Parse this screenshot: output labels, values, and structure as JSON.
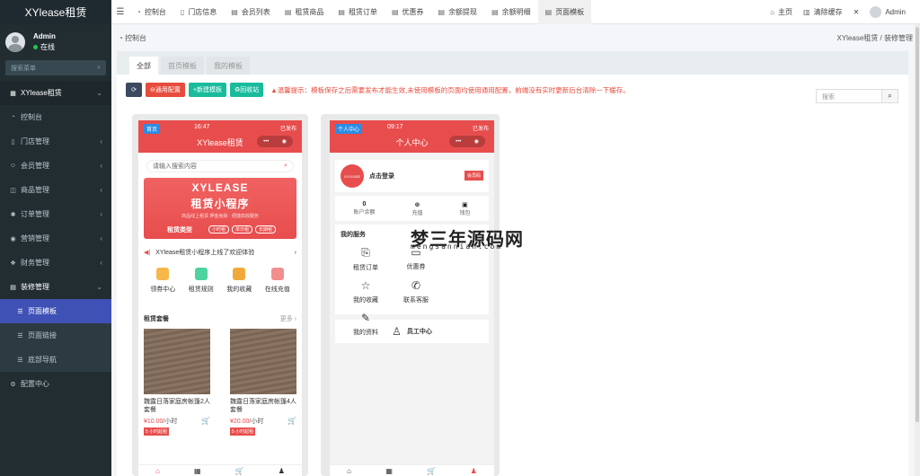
{
  "sidebar": {
    "brand": "XYlease租赁",
    "user": {
      "name": "Admin",
      "status": "在线"
    },
    "search_placeholder": "搜索菜单",
    "items": [
      {
        "label": "XYlease租赁",
        "icon": "grid-icon"
      },
      {
        "label": "控制台",
        "icon": "dashboard-icon"
      },
      {
        "label": "门店管理",
        "icon": "store-icon"
      },
      {
        "label": "会员管理",
        "icon": "user-icon"
      },
      {
        "label": "商品管理",
        "icon": "box-icon"
      },
      {
        "label": "订单管理",
        "icon": "order-icon"
      },
      {
        "label": "营销管理",
        "icon": "marketing-icon"
      },
      {
        "label": "财务管理",
        "icon": "finance-icon"
      },
      {
        "label": "装修管理",
        "icon": "paint-icon"
      },
      {
        "label": "页面模板",
        "icon": "list-icon"
      },
      {
        "label": "页面链接",
        "icon": "list-icon"
      },
      {
        "label": "底部导航",
        "icon": "list-icon"
      },
      {
        "label": "配置中心",
        "icon": "gear-icon"
      }
    ]
  },
  "topbar": {
    "tabs": [
      "控制台",
      "门店信息",
      "会员列表",
      "租赁商品",
      "租赁订单",
      "优惠券",
      "余额提现",
      "余额明细",
      "页面模板"
    ],
    "home": "主页",
    "clear_cache": "清除缓存",
    "admin": "Admin"
  },
  "crumb": {
    "left": "控制台",
    "right1": "XYlease租赁",
    "sep": "/",
    "right2": "装修管理"
  },
  "panel": {
    "tabs": [
      "全部",
      "首页模板",
      "我的模板"
    ],
    "buttons": {
      "general": "通用配置",
      "new": "新建模板",
      "recycle": "回收站"
    },
    "warning": "温馨提示：模板保存之后需要发布才能生效,未使用模板的页面均使用通用配置，前端没有实时更新后台清除一下缓存。",
    "search_placeholder": "搜索"
  },
  "phone1": {
    "badge": "首页",
    "time": "16:47",
    "signal": "已发布",
    "title": "XYlease租赁",
    "search": "请输入搜索内容",
    "banner": {
      "t1": "XYLEASE",
      "t2": "租赁小程序",
      "t3": "商品线上租赁 押金免除 · 便捷高效服务",
      "t4": "租赁类型",
      "chips": [
        "小时租",
        "单日租",
        "长期租"
      ]
    },
    "notice": "XYlease租赁小程序上线了欢迎体验",
    "grid": [
      {
        "label": "领券中心",
        "color": "#f7b84b"
      },
      {
        "label": "租赁规则",
        "color": "#4cd3a0"
      },
      {
        "label": "我的收藏",
        "color": "#f2a93b"
      },
      {
        "label": "在线充值",
        "color": "#f28e8e"
      }
    ],
    "section": {
      "title": "租赁套餐",
      "more": "更多"
    },
    "products": [
      {
        "name": "魏露日落家庭房帐篷2人套餐",
        "price": "¥10.00",
        "unit": "/小时",
        "tag": "5 小时起租"
      },
      {
        "name": "魏露日落家庭房帐篷4人套餐",
        "price": "¥20.00",
        "unit": "/小时",
        "tag": "5 小时起租"
      }
    ]
  },
  "phone2": {
    "badge": "个人中心",
    "time": "09:17",
    "signal": "已发布",
    "title": "个人中心",
    "login": "点击登录",
    "logo": "XYLEASE",
    "vip": "会员码",
    "stats": [
      {
        "value": "0",
        "label": "账户余额"
      },
      {
        "value": "",
        "label": "充值"
      },
      {
        "value": "",
        "label": "钱包"
      }
    ],
    "services_title": "我的服务",
    "services": [
      {
        "label": "租赁订单",
        "icon": "clipboard-icon"
      },
      {
        "label": "优惠券",
        "icon": "coupon-icon"
      },
      {
        "label": "我的收藏",
        "icon": "star-icon"
      },
      {
        "label": "联系客服",
        "icon": "phone-icon"
      },
      {
        "label": "我的资料",
        "icon": "profile-icon"
      }
    ],
    "staff": "员工中心"
  },
  "watermark": {
    "main": "梦三年源码网",
    "sub": "mengsannian.com"
  }
}
